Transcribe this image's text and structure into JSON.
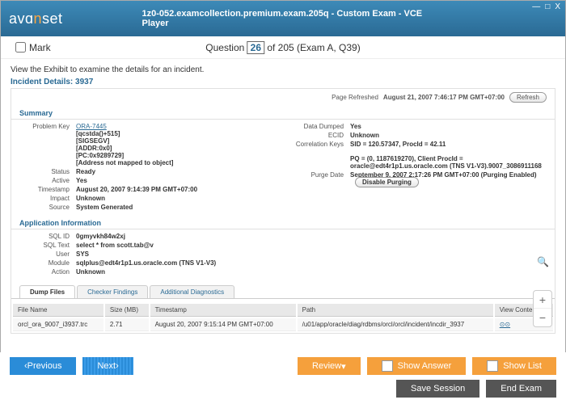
{
  "window": {
    "title": "1z0-052.examcollection.premium.exam.205q - Custom Exam - VCE Player",
    "min": "—",
    "max": "□",
    "close": "X"
  },
  "logo": {
    "pre": "avɑ",
    "accent": "n",
    "post": "set"
  },
  "qbar": {
    "mark": "Mark",
    "qlabel": "Question",
    "num": "26",
    "rest": " of 205 (Exam A, Q39)"
  },
  "instr": "View the Exhibit to examine the details for an incident.",
  "heading": "Incident Details: 3937",
  "refresh": {
    "label": "Page Refreshed",
    "time": "August 21, 2007 7:46:17 PM GMT+07:00",
    "btn": "Refresh"
  },
  "summary": "Summary",
  "left": {
    "problemkey": "Problem Key",
    "pk": [
      "ORA-7445",
      "[qcstda()+515]",
      "[SIGSEGV]",
      "[ADDR:0x0]",
      "[PC:0x9289729]",
      "[Address not mapped to object]"
    ],
    "status_l": "Status",
    "status_v": "Ready",
    "active_l": "Active",
    "active_v": "Yes",
    "ts_l": "Timestamp",
    "ts_v": "August 20, 2007 9:14:39 PM GMT+07:00",
    "imp_l": "Impact",
    "imp_v": "Unknown",
    "src_l": "Source",
    "src_v": "System Generated"
  },
  "right": {
    "dd_l": "Data Dumped",
    "dd_v": "Yes",
    "ecid_l": "ECID",
    "ecid_v": "Unknown",
    "ck_l": "Correlation Keys",
    "ck_v": "SID = 120.57347, ProcId = 42.11",
    "ck_v2": "PQ = (0, 1187619270), Client ProcId = oracle@edt4r1p1.us.oracle.com (TNS V1-V3).9007_3086911168",
    "pd_l": "Purge Date",
    "pd_v": "September 9, 2007 2:17:26 PM GMT+07:00 (Purging Enabled)",
    "pd_btn": "Disable Purging"
  },
  "appinfo": {
    "h": "Application Information",
    "sqlid_l": "SQL ID",
    "sqlid_v": "0gmyvkh84w2xj",
    "sqlt_l": "SQL Text",
    "sqlt_v": "select * from scott.tab@v",
    "user_l": "User",
    "user_v": "SYS",
    "mod_l": "Module",
    "mod_v": "sqlplus@edt4r1p1.us.oracle.com (TNS V1-V3)",
    "act_l": "Action",
    "act_v": "Unknown"
  },
  "tabs": {
    "t1": "Dump Files",
    "t2": "Checker Findings",
    "t3": "Additional Diagnostics"
  },
  "table": {
    "h1": "File Name",
    "h2": "Size (MB)",
    "h3": "Timestamp",
    "h4": "Path",
    "h5": "View Contents",
    "r1": {
      "fn": "orcl_ora_9007_i3937.trc",
      "sz": "2.71",
      "ts": "August 20, 2007 9:15:14 PM GMT+07:00",
      "path": "/u01/app/oracle/diag/rdbms/orcl/orcl/incident/incdir_3937",
      "vc": "⊙⊙"
    }
  },
  "nav": {
    "prev": "Previous",
    "next": "Next",
    "review": "Review",
    "showans": "Show Answer",
    "showlist": "Show List",
    "save": "Save Session",
    "end": "End Exam"
  }
}
